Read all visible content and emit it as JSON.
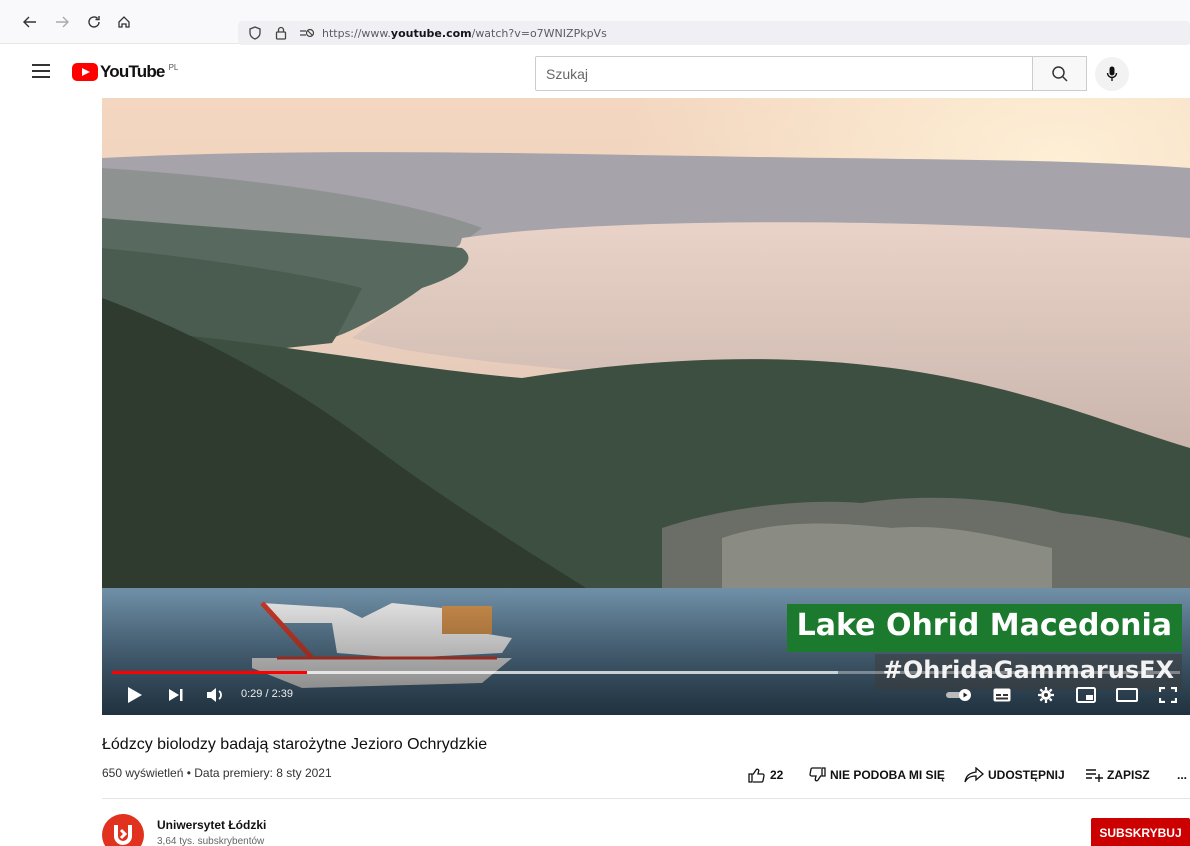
{
  "browser": {
    "url_prefix": "https://www.",
    "url_domain": "youtube.com",
    "url_path": "/watch?v=o7WNIZPkpVs"
  },
  "header": {
    "logo_text": "YouTube",
    "country_code": "PL",
    "search_placeholder": "Szukaj"
  },
  "video": {
    "overlay_title": "Lake Ohrid Macedonia",
    "overlay_hashtag": "#OhridaGammarusEX",
    "time_display": "0:29 / 2:39",
    "progress_fraction": 0.1823,
    "buffered_fraction": 0.68
  },
  "info": {
    "title": "Łódzcy biolodzy badają starożytne Jezioro Ochrydzkie",
    "views": "650 wyświetleń",
    "separator": " • ",
    "premiere": "Data premiery: 8 sty 2021",
    "likes": "22",
    "dislike_label": "NIE PODOBA MI SIĘ",
    "share_label": "UDOSTĘPNIJ",
    "save_label": "ZAPISZ",
    "more_label": "..."
  },
  "channel": {
    "name": "Uniwersytet Łódzki",
    "subscribers": "3,64 tys. subskrybentów",
    "subscribe_label": "SUBSKRYBUJ"
  },
  "colors": {
    "brand_red": "#ff0000",
    "subscribe_red": "#cc0000",
    "overlay_green": "#1b7a2e"
  }
}
